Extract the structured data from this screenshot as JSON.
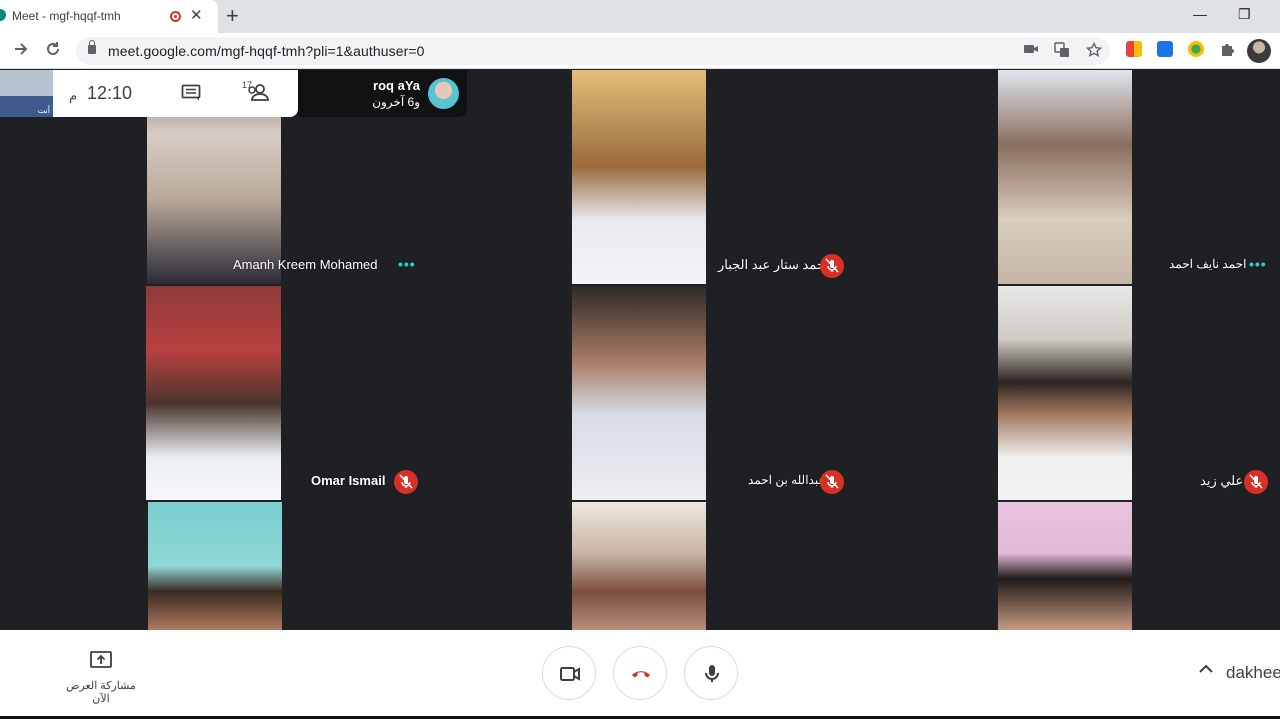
{
  "browser": {
    "tab_title": "Meet - mgf-hqqf-tmh",
    "close_glyph": "✕",
    "new_tab_glyph": "+",
    "url": "meet.google.com/mgf-hqqf-tmh?pli=1&authuser=0",
    "window_controls": {
      "minimize": "—",
      "restore": "❐"
    }
  },
  "self_view": {
    "label": "أنت"
  },
  "info_panel": {
    "time": "12:10",
    "ampm": "م",
    "participants_count": "17"
  },
  "presenter": {
    "name": "roq aYa",
    "others": "و6 آخرون"
  },
  "participants": [
    {
      "name": "Amanh Kreem Mohamed",
      "status": "speaking"
    },
    {
      "name": "احمد ستار عبد الجبار",
      "status": "muted"
    },
    {
      "name": "احمد نايف احمد",
      "status": "speaking"
    },
    {
      "name": "Omar Ismail",
      "status": "muted"
    },
    {
      "name": "عبدالله بن احمد",
      "status": "muted"
    },
    {
      "name": "علي زيد",
      "status": "muted"
    },
    {
      "name": "",
      "status": ""
    },
    {
      "name": "",
      "status": ""
    },
    {
      "name": "",
      "status": ""
    }
  ],
  "controls": {
    "present_label": "مشاركة العرض الآن",
    "meeting_code": "dakhee"
  },
  "colors": {
    "mute_red": "#d93025",
    "speaking_teal": "#27d3c3",
    "stage_bg": "#202124"
  }
}
